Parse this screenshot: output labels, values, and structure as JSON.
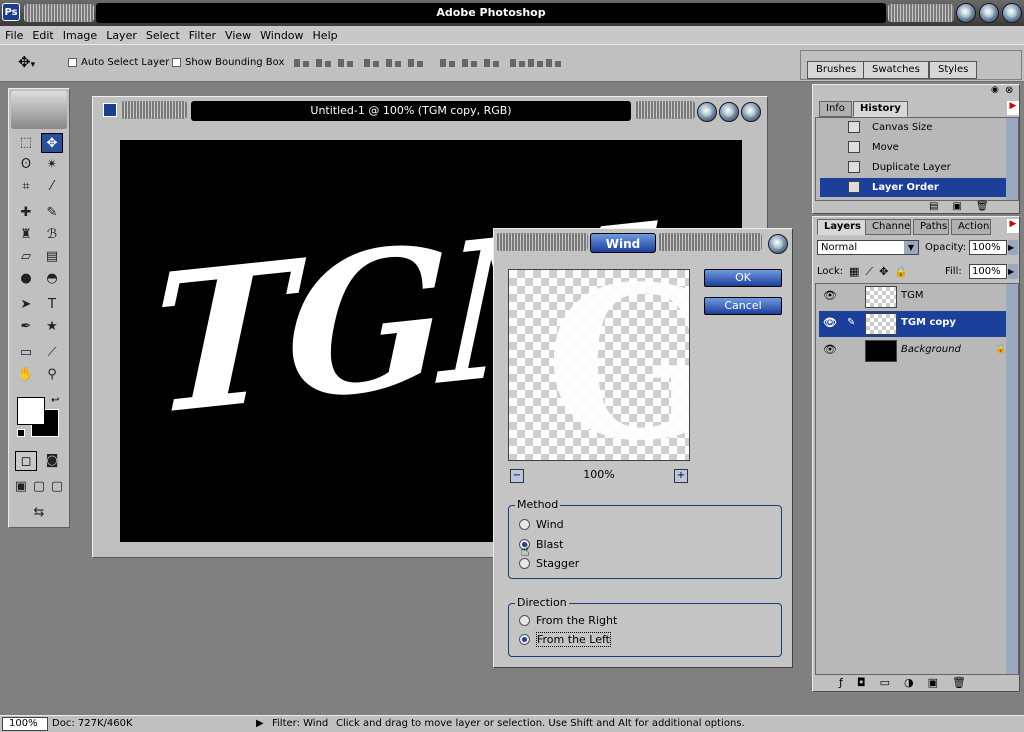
{
  "app": {
    "title": "Adobe Photoshop",
    "logo": "Ps"
  },
  "menu": [
    "File",
    "Edit",
    "Image",
    "Layer",
    "Select",
    "Filter",
    "View",
    "Window",
    "Help"
  ],
  "options": {
    "auto_select_layer": "Auto Select Layer",
    "show_bounding_box": "Show Bounding Box"
  },
  "palette_well": {
    "tabs": [
      "Brushes",
      "Swatches",
      "Styles"
    ]
  },
  "document": {
    "title": "Untitled-1 @ 100% (TGM copy, RGB)",
    "canvas_text": "TGM"
  },
  "wind_dialog": {
    "title": "Wind",
    "ok": "OK",
    "cancel": "Cancel",
    "zoom": "100%",
    "zoom_out": "−",
    "zoom_in": "+",
    "preview_glyph": "G",
    "method": {
      "label": "Method",
      "options": [
        "Wind",
        "Blast",
        "Stagger"
      ],
      "selected": "Blast"
    },
    "direction": {
      "label": "Direction",
      "options": [
        "From the Right",
        "From the Left"
      ],
      "selected": "From the Left"
    }
  },
  "history_palette": {
    "tabs": [
      "Info",
      "History"
    ],
    "items": [
      "Canvas Size",
      "Move",
      "Duplicate Layer",
      "Layer Order"
    ],
    "selected": "Layer Order"
  },
  "layers_palette": {
    "tabs": [
      "Layers",
      "Channels",
      "Paths",
      "Actions"
    ],
    "blend_mode": "Normal",
    "opacity_label": "Opacity:",
    "opacity": "100%",
    "lock_label": "Lock:",
    "fill_label": "Fill:",
    "fill": "100%",
    "layers": [
      "TGM",
      "TGM copy",
      "Background"
    ],
    "selected": "TGM copy"
  },
  "status": {
    "zoom": "100%",
    "doc": "Doc: 727K/460K",
    "filter": "Filter: Wind",
    "hint": "Click and drag to move layer or selection.  Use Shift and Alt for additional options."
  },
  "colors": {
    "selection": "#1c3f9a",
    "chrome": "#c0c0c0"
  }
}
